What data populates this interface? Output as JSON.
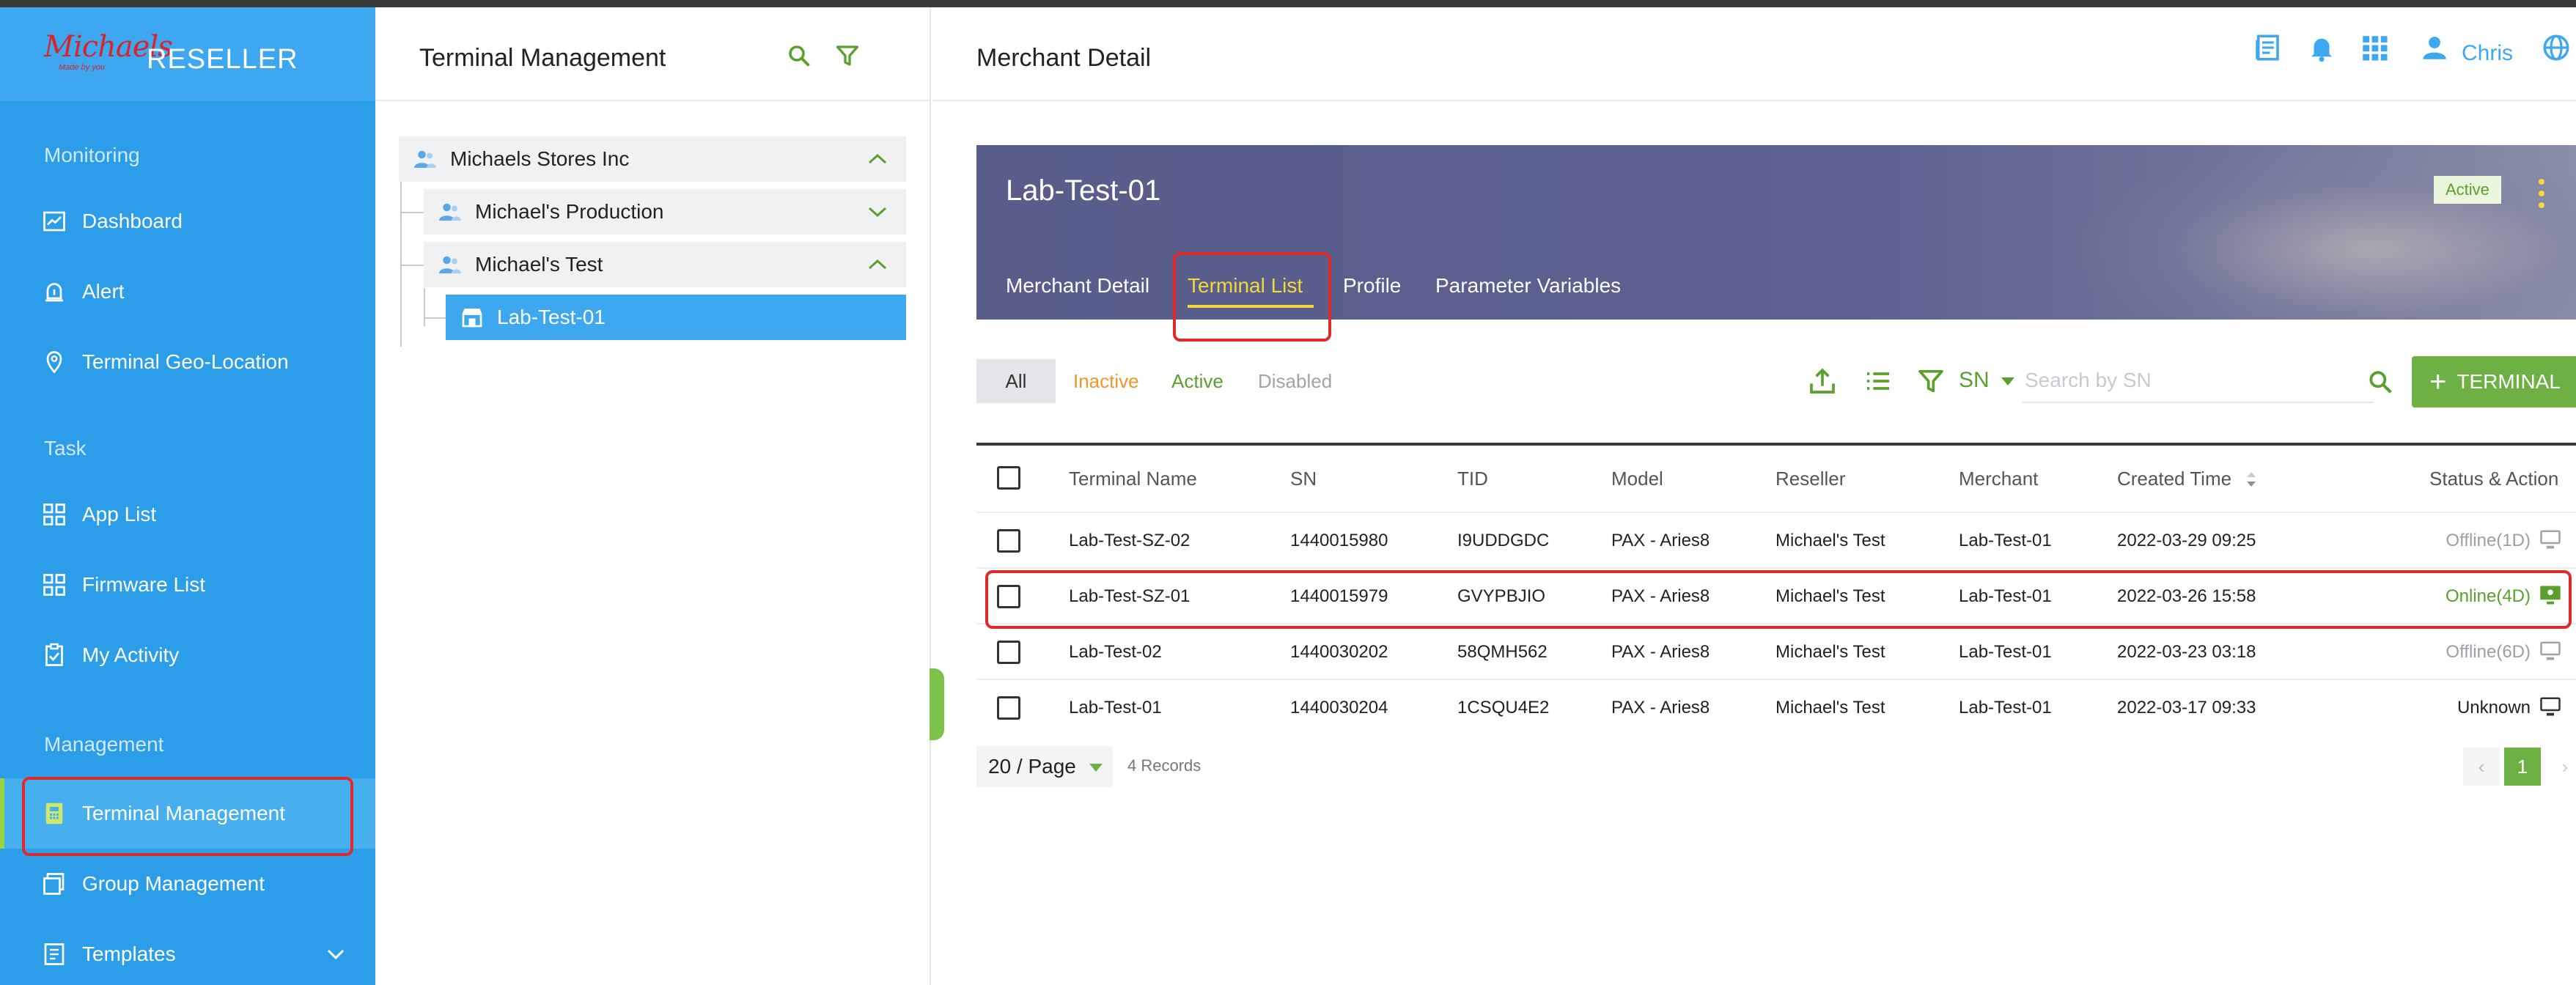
{
  "brand": {
    "logo_text": "Michaels",
    "logo_tagline": "Made by you",
    "title": "RESELLER"
  },
  "sidebar": {
    "sections": [
      {
        "label": "Monitoring"
      },
      {
        "label": "Task"
      },
      {
        "label": "Management"
      }
    ],
    "items": [
      {
        "label": "Dashboard",
        "icon": "chart-icon"
      },
      {
        "label": "Alert",
        "icon": "alert-icon"
      },
      {
        "label": "Terminal Geo-Location",
        "icon": "location-icon"
      },
      {
        "label": "App List",
        "icon": "grid-icon"
      },
      {
        "label": "Firmware List",
        "icon": "grid-icon"
      },
      {
        "label": "My Activity",
        "icon": "clipboard-icon"
      },
      {
        "label": "Terminal Management",
        "icon": "terminal-icon",
        "active": true
      },
      {
        "label": "Group Management",
        "icon": "group-icon"
      },
      {
        "label": "Templates",
        "icon": "template-icon",
        "expandable": true
      }
    ]
  },
  "middle": {
    "title": "Terminal Management",
    "tree": [
      {
        "label": "Michaels Stores Inc",
        "state": "expanded"
      },
      {
        "label": "Michael's Production",
        "state": "collapsed"
      },
      {
        "label": "Michael's Test",
        "state": "expanded"
      },
      {
        "label": "Lab-Test-01",
        "state": "selected"
      }
    ]
  },
  "header": {
    "title": "Merchant Detail",
    "user_name": "Chris"
  },
  "banner": {
    "title": "Lab-Test-01",
    "status": "Active",
    "tabs": [
      "Merchant Detail",
      "Terminal List",
      "Profile",
      "Parameter Variables"
    ],
    "active_tab": "Terminal List"
  },
  "filters": {
    "all": "All",
    "inactive": "Inactive",
    "active": "Active",
    "disabled": "Disabled",
    "search_type": "SN",
    "search_placeholder": "Search by SN",
    "add_label": "TERMINAL"
  },
  "table": {
    "columns": [
      "Terminal Name",
      "SN",
      "TID",
      "Model",
      "Reseller",
      "Merchant",
      "Created Time",
      "Status & Action"
    ],
    "rows": [
      {
        "name": "Lab-Test-SZ-02",
        "sn": "1440015980",
        "tid": "I9UDDGDC",
        "model": "PAX - Aries8",
        "reseller": "Michael's Test",
        "merchant": "Lab-Test-01",
        "created": "2022-03-29 09:25",
        "status": "Offline(1D)",
        "status_color": "#9aa0a6"
      },
      {
        "name": "Lab-Test-SZ-01",
        "sn": "1440015979",
        "tid": "GVYPBJIO",
        "model": "PAX - Aries8",
        "reseller": "Michael's Test",
        "merchant": "Lab-Test-01",
        "created": "2022-03-26 15:58",
        "status": "Online(4D)",
        "status_color": "#5aa02c"
      },
      {
        "name": "Lab-Test-02",
        "sn": "1440030202",
        "tid": "58QMH562",
        "model": "PAX - Aries8",
        "reseller": "Michael's Test",
        "merchant": "Lab-Test-01",
        "created": "2022-03-23 03:18",
        "status": "Offline(6D)",
        "status_color": "#9aa0a6"
      },
      {
        "name": "Lab-Test-01",
        "sn": "1440030204",
        "tid": "1CSQU4E2",
        "model": "PAX - Aries8",
        "reseller": "Michael's Test",
        "merchant": "Lab-Test-01",
        "created": "2022-03-17 09:33",
        "status": "Unknown",
        "status_color": "#222222"
      }
    ]
  },
  "pagination": {
    "page_size": "20 / Page",
    "records": "4 Records",
    "current_page": "1",
    "prev": "‹",
    "next": "›"
  },
  "colors": {
    "sidebar": "#2c9de9",
    "accent_green": "#6db145",
    "banner": "#5c6190",
    "highlight": "#e02a2a"
  }
}
